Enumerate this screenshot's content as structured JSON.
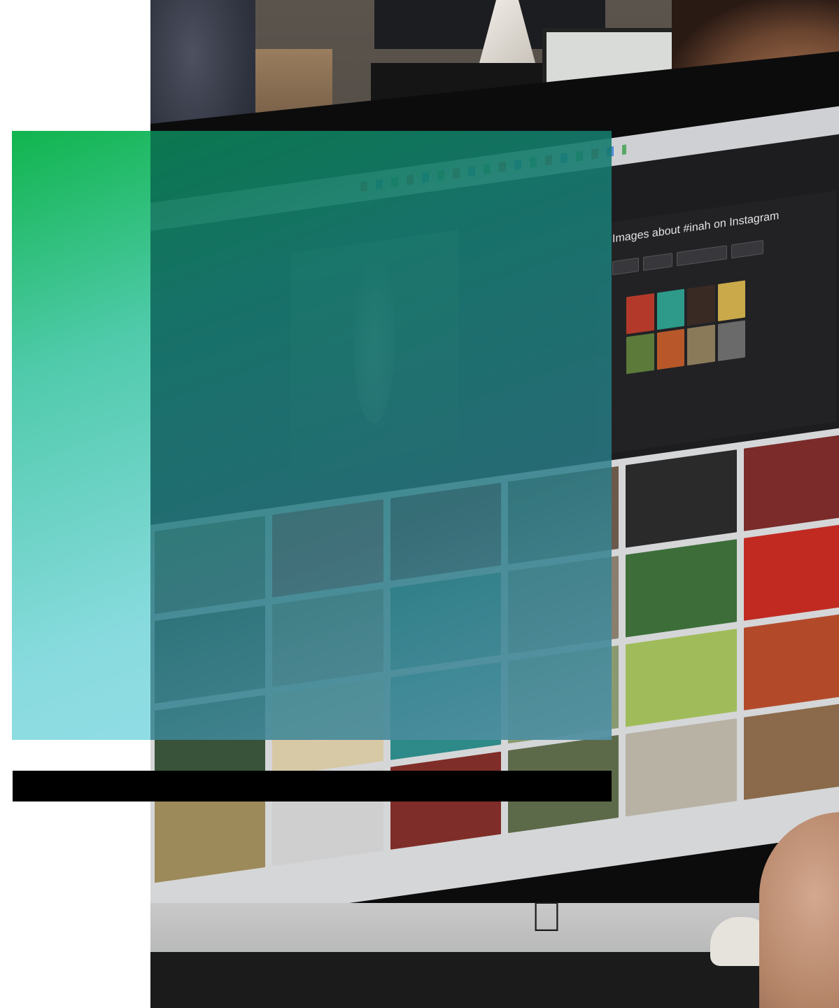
{
  "photo": {
    "description_visible": false,
    "screen": {
      "panel_title": "Images about #inah on Instagram",
      "grid_colors": [
        "#7e6a55",
        "#b53a3a",
        "#7a2b2a",
        "#6b5a4b",
        "#2a2a2a",
        "#7a2b2a",
        "#4b4f3f",
        "#a78670",
        "#2f7c74",
        "#8a7f6f",
        "#3d6e3a",
        "#c12a21",
        "#39523a",
        "#d7c8a6",
        "#2d8a88",
        "#8a9a70",
        "#a0bc5a",
        "#b24a2a",
        "#9c8a5a",
        "#cfcfd0",
        "#7f2d28",
        "#5c6a4a",
        "#b8b2a4",
        "#8a6a4a"
      ],
      "thumb_colors": [
        "#b33a2a",
        "#2d9a8a",
        "#3a2a24",
        "#c9a94a",
        "#5c7a3a",
        "#b8582a",
        "#8a7a5a",
        "#6a6a6a"
      ]
    },
    "logo_icon": "apple-logo-icon"
  },
  "overlay": {
    "gradient_start": "#09b248",
    "gradient_end": "#96ddef"
  },
  "caption_bar": {
    "color": "#000000"
  }
}
